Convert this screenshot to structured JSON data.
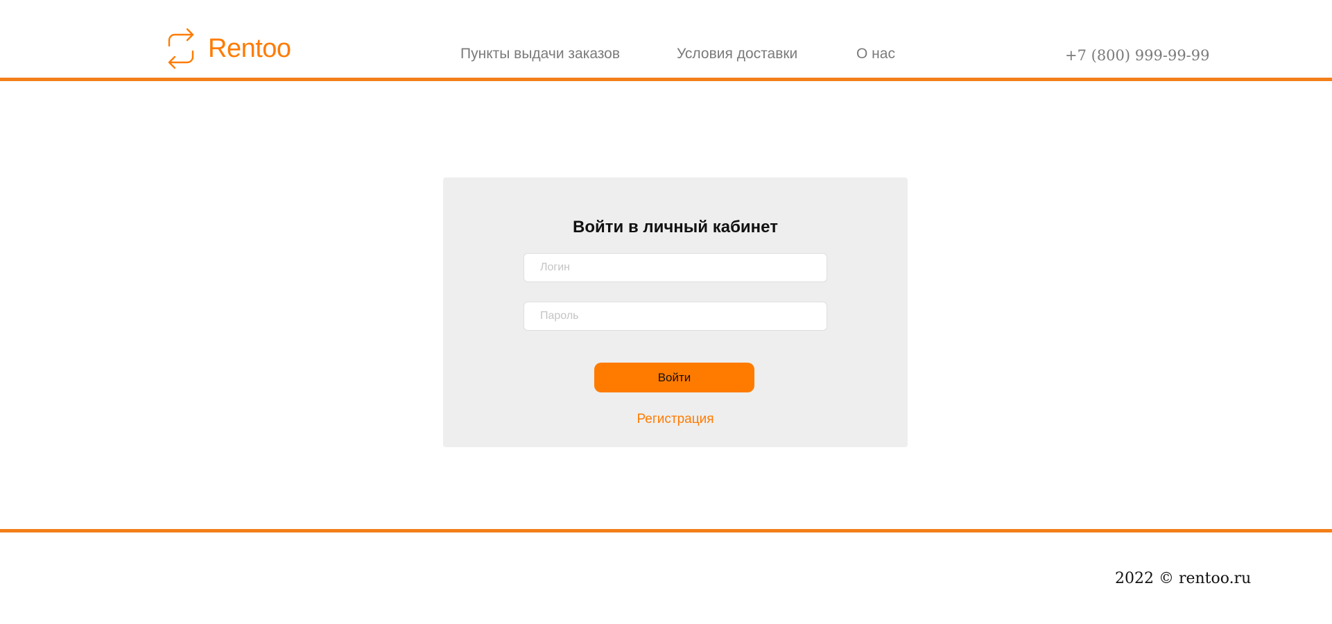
{
  "header": {
    "logo_text": "Rentoo",
    "logo_icon": "repeat-arrows-icon",
    "nav": [
      {
        "label": "Пункты выдачи заказов"
      },
      {
        "label": "Условия доставки"
      },
      {
        "label": "О нас"
      }
    ],
    "phone": "+7 (800) 999-99-99"
  },
  "login": {
    "title": "Войти в личный кабинет",
    "login_value": "",
    "login_placeholder": "Логин",
    "password_value": "",
    "password_placeholder": "Пароль",
    "submit_label": "Войти",
    "register_label": "Регистрация"
  },
  "footer": {
    "copyright": "2022 © rentoo.ru"
  },
  "colors": {
    "accent": "#ff7b00",
    "divider": "#f37f1a",
    "card_bg": "#eeeeee",
    "nav_text": "#7a7a7a"
  }
}
